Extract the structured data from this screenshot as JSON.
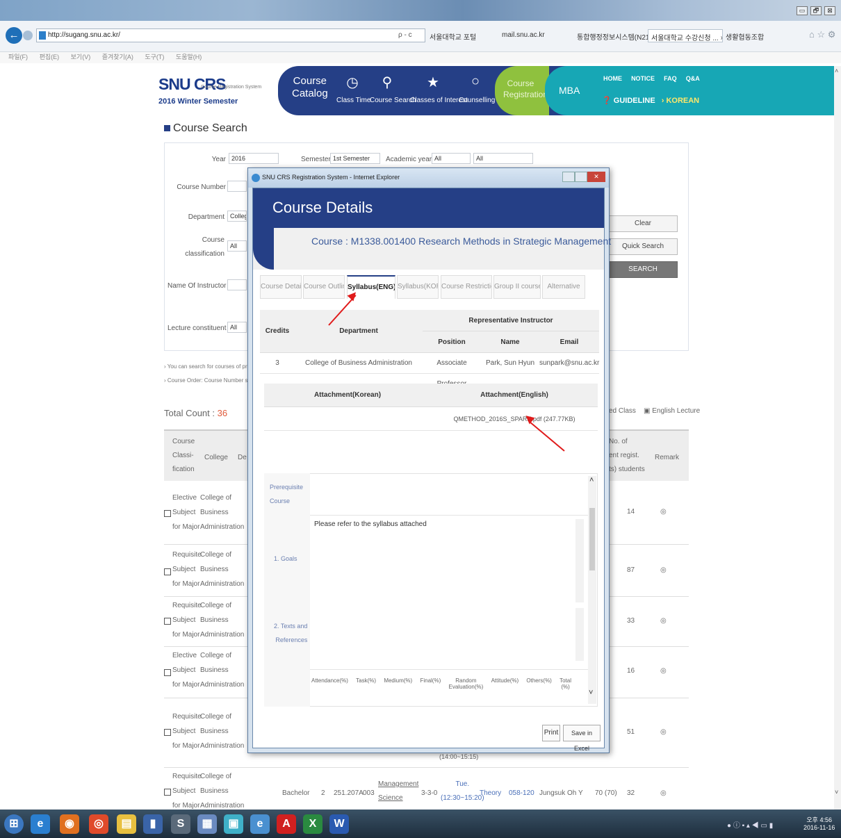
{
  "browser": {
    "address": "http://sugang.snu.ac.kr/",
    "search_glyph": "ρ - c",
    "tabs": [
      "서울대학교 포털",
      "mail.snu.ac.kr",
      "통합행정정보시스템(N21)",
      "서울대학교 수강신청 ... ×",
      "생활협동조합"
    ],
    "menu": [
      "파일(F)",
      "편집(E)",
      "보기(V)",
      "즐겨찾기(A)",
      "도구(T)",
      "도움말(H)"
    ],
    "window_controls": [
      "▭",
      "🗗",
      "⊠"
    ]
  },
  "site": {
    "logo": "SNU CRS",
    "logo_sub": "Course Registration System",
    "semester": "2016 Winter Semester",
    "nav": [
      {
        "label": "Course\nCatalog"
      },
      {
        "label": "Class Time"
      },
      {
        "label": "Course Search"
      },
      {
        "label": "Classes of Interest"
      },
      {
        "label": "Counselling"
      },
      {
        "label": "Course\nRegistration"
      },
      {
        "label": "MBA"
      }
    ],
    "top_links": [
      "HOME",
      "NOTICE",
      "FAQ",
      "Q&A"
    ],
    "guideline": "GUIDELINE",
    "korean": "› KOREAN"
  },
  "search": {
    "title": "Course Search",
    "year_label": "Year",
    "year_value": "2016",
    "semester_label": "Semester",
    "semester_value": "1st Semester",
    "academic_year_label": "Academic year",
    "academic_year_value": "All",
    "all_value": "All",
    "course_number_label": "Course Number",
    "department_label": "Department",
    "department_value": "College",
    "classification_label": "Course\nclassification",
    "classification_value": "All",
    "instructor_label": "Name Of Instructor",
    "lecture_label": "Lecture constituent",
    "lecture_value": "All",
    "clear": "Clear",
    "quick_search": "Quick Search",
    "search": "SEARCH",
    "note1": "› You can search for courses of previ...",
    "note2": "› Course Order: Course Number startin...",
    "total_label": "Total Count :",
    "total_value": "36",
    "legend1": "ed Class",
    "legend2": "▣ English Lecture"
  },
  "results": {
    "headers": [
      "Course\nClassi-\nfication",
      "College",
      "De",
      "No. of\nent regist.\nts) students",
      "Remark"
    ],
    "rows": [
      {
        "type": "Elective\nSubject\nfor Major",
        "college": "College of\nBusiness\nAdministration",
        "count": "14"
      },
      {
        "type": "Requisite\nSubject\nfor Major",
        "college": "College of\nBusiness\nAdministration",
        "count": "87"
      },
      {
        "type": "Requisite\nSubject\nfor Major",
        "college": "College of\nBusiness\nAdministration",
        "count": "33"
      },
      {
        "type": "Elective\nSubject\nfor Major",
        "college": "College of\nBusiness\nAdministration",
        "count": "16"
      },
      {
        "type": "Requisite\nSubject\nfor Major",
        "college": "College of\nBusiness\nAdministration",
        "count": "51"
      },
      {
        "type": "Requisite\nSubject\nfor Major",
        "college": "College of\nBusiness\nAdministration",
        "count": "32"
      }
    ],
    "last_row": {
      "level": "Bachelor",
      "credit": "2",
      "number": "251.207A",
      "section": "003",
      "dept": "Management\nScience",
      "hours": "3-3-0",
      "time": "Tue.\n(12:30~15:20)",
      "type": "Theory",
      "room": "058-120",
      "instructor": "Jungsuk Oh",
      "y": "Y",
      "cap": "70 (70)"
    },
    "partial_time": "(14:00~15:15)",
    "remark_icon": "◎"
  },
  "popup": {
    "window_title": "SNU CRS Registration System - Internet Explorer",
    "header": "Course Details",
    "course": "Course : M1338.001400 Research Methods in Strategic Management",
    "tabs": [
      "Course Details",
      "Course Outline",
      "Syllabus(ENG)",
      "Syllabus(KOR)",
      "Course Restriction",
      "Group II courses",
      "Alternative"
    ],
    "table": {
      "credits_h": "Credits",
      "department_h": "Department",
      "rep_h": "Representative Instructor",
      "position_h": "Position",
      "name_h": "Name",
      "email_h": "Email",
      "credits": "3",
      "department": "College of Business Administration",
      "position": "Associate Professor",
      "name": "Park, Sun Hyun",
      "email": "sunpark@snu.ac.kr"
    },
    "attach_kor_h": "Attachment(Korean)",
    "attach_eng_h": "Attachment(English)",
    "attach_eng": "QMETHOD_2016S_SPARK.pdf (247.77KB)",
    "prereq": "Prerequisite\nCourse",
    "goals_label": "1. Goals",
    "goals_text": "Please refer to the syllabus attached",
    "texts_label": "2. Texts and\nReferences",
    "grading": [
      "Attendance(%)",
      "Task(%)",
      "Medium(%)",
      "Final(%)",
      "Random\nEvaluation(%)",
      "Attitude(%)",
      "Others(%)",
      "Total\n(%)"
    ],
    "print": "Print",
    "excel": "Save in Excel"
  },
  "taskbar": {
    "clock_time": "오후 4:56",
    "clock_date": "2016-11-16",
    "tray": "● ⓘ ▪ ▴ ◀ ▭ ▮"
  },
  "colors": {
    "navy": "#253f86",
    "green": "#8fc13e",
    "teal": "#17a7b5",
    "arrow": "#e01b1b"
  }
}
